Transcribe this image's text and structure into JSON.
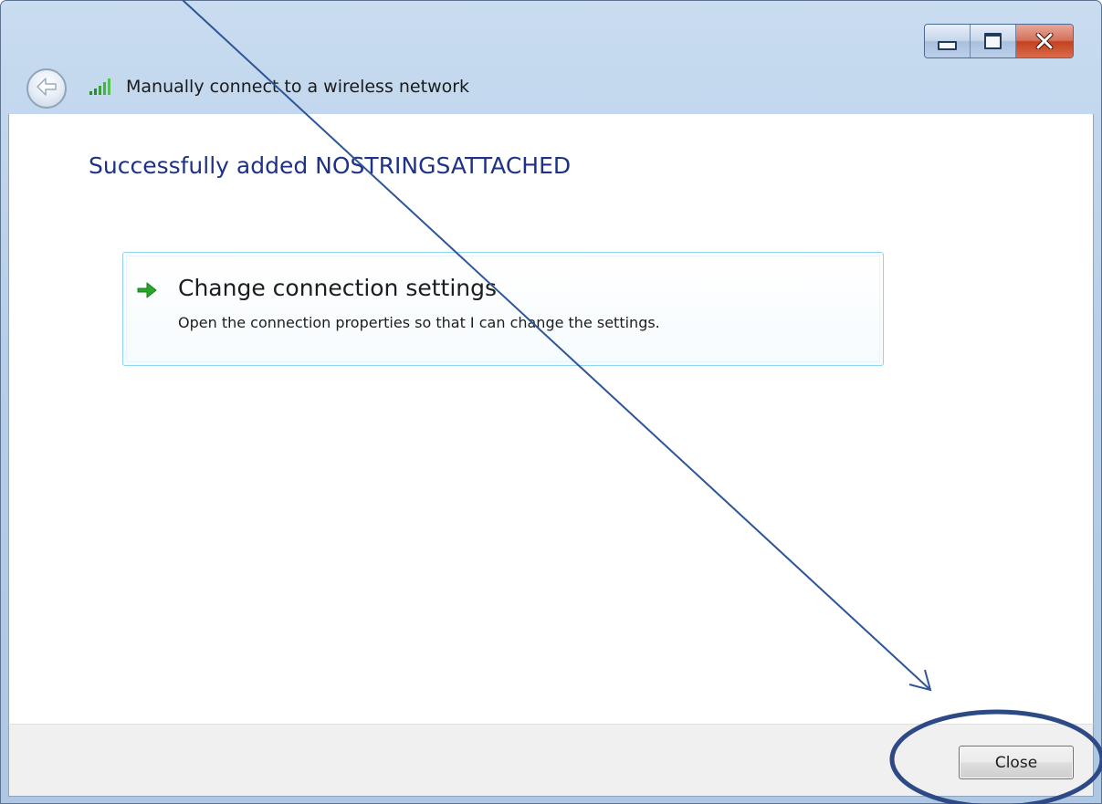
{
  "window": {
    "title": "Manually connect to a wireless network",
    "minimize_icon": "minimize-icon",
    "maximize_icon": "maximize-icon",
    "close_icon": "close-icon",
    "back_icon": "back-arrow-icon",
    "signal_icon": "wireless-signal-icon"
  },
  "content": {
    "heading": "Successfully added NOSTRINGSATTACHED",
    "command_link": {
      "icon": "green-arrow-icon",
      "title": "Change connection settings",
      "description": "Open the connection properties so that I can change the settings."
    }
  },
  "footer": {
    "close_label": "Close"
  },
  "colors": {
    "heading": "#1e3287",
    "caption": "#b7cfe9",
    "link_border": "#8fd5ef",
    "annotation": "#2e5597",
    "arrow_green": "#2aa52a"
  }
}
